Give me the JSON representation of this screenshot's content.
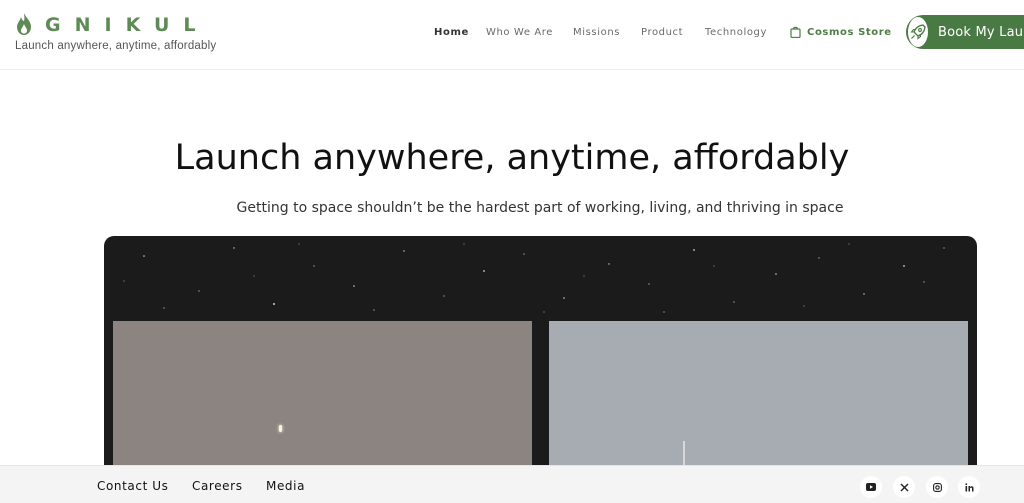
{
  "brand": {
    "name": "GNIKUL",
    "tagline": "Launch anywhere, anytime, affordably",
    "accent_color": "#5e8a55",
    "logo_icon": "flame-icon"
  },
  "nav": {
    "items": [
      {
        "label": "Home",
        "active": true
      },
      {
        "label": "Who We Are",
        "active": false
      },
      {
        "label": "Missions",
        "active": false
      },
      {
        "label": "Product",
        "active": false
      },
      {
        "label": "Technology",
        "active": false
      }
    ],
    "store": {
      "label": "Cosmos Store",
      "icon": "shopping-bag-icon"
    },
    "cta": {
      "label": "Book My Launch",
      "icon": "rocket-icon",
      "color": "#4a7a43"
    }
  },
  "hero": {
    "title": "Launch anywhere, anytime, affordably",
    "subtitle": "Getting to space shouldn’t be the hardest part of working, living, and thriving in space"
  },
  "footer": {
    "links": [
      "Contact Us",
      "Careers",
      "Media"
    ],
    "social": [
      {
        "name": "youtube-icon",
        "glyph": "▶"
      },
      {
        "name": "x-icon",
        "glyph": "𝕏"
      },
      {
        "name": "instagram-icon",
        "glyph": "◎"
      },
      {
        "name": "linkedin-icon",
        "glyph": "in"
      }
    ]
  }
}
